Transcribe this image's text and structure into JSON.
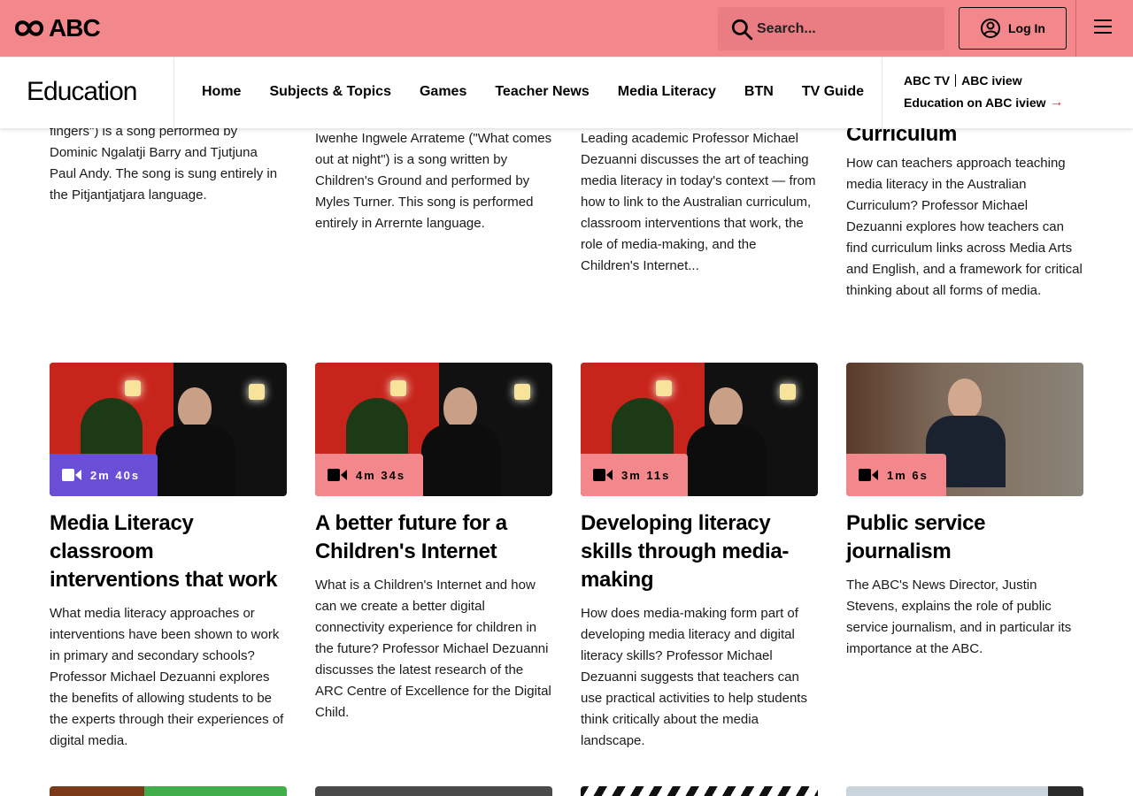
{
  "header": {
    "brand": "ABC",
    "search_placeholder": "Search...",
    "login_label": "Log In"
  },
  "nav": {
    "section_title": "Education",
    "links": [
      "Home",
      "Subjects & Topics",
      "Games",
      "Teacher News",
      "Media Literacy",
      "BTN",
      "TV Guide"
    ],
    "iview_logo_left": "ABC TV",
    "iview_logo_right": "ABC iview",
    "iview_link": "Education on ABC iview"
  },
  "top_row": [
    {
      "desc": "fingers\") is a song performed by Dominic Ngalatji Barry and Tjutjuna Paul Andy. The song is sung entirely in the Pitjantjatjara language."
    },
    {
      "desc": "Iwenhe Ingwele Arrateme (\"What comes out at night\") is a song written by Children's Ground and performed by Myles Turner. This song is performed entirely in Arrernte language."
    },
    {
      "desc": "Leading academic Professor Michael Dezuanni discusses the art of teaching media literacy in today's context — from how to link to the Australian curriculum, classroom interventions that work, the role of media-making, and the Children's Internet..."
    },
    {
      "title": "Curriculum",
      "desc": "How can teachers approach teaching media literacy in the Australian Curriculum?  Professor Michael Dezuanni explores how teachers can find curriculum links across Media Arts and English, and a framework for critical thinking about all forms of media."
    }
  ],
  "cards": [
    {
      "duration": "2m 40s",
      "title": "Media Literacy classroom interventions that work",
      "desc": "What media literacy approaches or interventions have been shown to work in primary and secondary schools? Professor Michael Dezuanni explores the benefits of allowing students to be the experts through their experiences of digital media."
    },
    {
      "duration": "4m 34s",
      "title": "A better future for a Children's Internet",
      "desc": "What is a Children's Internet and how can we create a better digital connectivity experience for children in the future? Professor Michael Dezuanni discusses the latest research of the ARC Centre of Excellence for the Digital Child."
    },
    {
      "duration": "3m 11s",
      "title": "Developing literacy skills through media-making",
      "desc": "How does media-making form part of developing media literacy and digital literacy skills? Professor Michael Dezuanni suggests that teachers can use practical activities to help students think critically about the media landscape."
    },
    {
      "duration": "1m 6s",
      "title": "Public service journalism",
      "desc": "The ABC's News Director, Justin Stevens, explains the role of public service journalism, and in particular its importance at the ABC."
    }
  ],
  "colors": {
    "brand_pink": "#f2878c",
    "badge_active": "#6a4fd6",
    "accent_red": "#d6283e"
  }
}
